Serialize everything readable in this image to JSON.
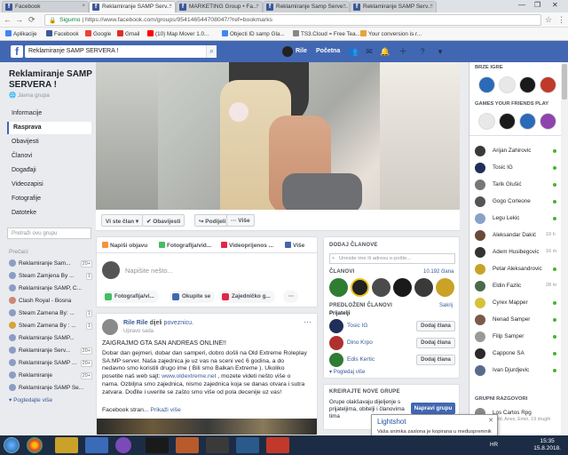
{
  "browser": {
    "tabs": [
      {
        "label": "Facebook",
        "active": false
      },
      {
        "label": "Reklamiranje SAMP Serv...",
        "active": true
      },
      {
        "label": "MARKETING Group • Fa...",
        "active": false
      },
      {
        "label": "Reklamiranje Samp Serve...",
        "active": false
      },
      {
        "label": "Reklamiranje SAMP Serv...",
        "active": false
      }
    ],
    "secure_label": "Sigurno",
    "url": "https://www.facebook.com/groups/954146544708047/?ref=bookmarks",
    "bookmarks": [
      {
        "label": "Aplikacije",
        "color": "#4285f4"
      },
      {
        "label": "Facebook",
        "color": "#3b5998"
      },
      {
        "label": "Google",
        "color": "#ea4335"
      },
      {
        "label": "Gmail",
        "color": "#d93025"
      },
      {
        "label": "(10) Map Mover 1.0...",
        "color": "#ff0000"
      },
      {
        "label": "Objecti ID samp Gla...",
        "color": "#4285f4"
      },
      {
        "label": "TS3.Cloud = Free Tea...",
        "color": "#888888"
      },
      {
        "label": "Your conversion is r...",
        "color": "#e8a33b"
      }
    ]
  },
  "fb_header": {
    "logo": "f",
    "search_value": "Reklamiranje SAMP SERVERA !",
    "user_name": "Rile",
    "home_label": "Početna"
  },
  "left_nav": {
    "group_title": "Reklamiranje SAMP SERVERA !",
    "group_type": "Javna grupa",
    "items": [
      {
        "label": "Informacije",
        "selected": false
      },
      {
        "label": "Rasprava",
        "selected": true
      },
      {
        "label": "Obavijesti",
        "selected": false
      },
      {
        "label": "Članovi",
        "selected": false
      },
      {
        "label": "Događaji",
        "selected": false
      },
      {
        "label": "Videozapisi",
        "selected": false
      },
      {
        "label": "Fotografije",
        "selected": false
      },
      {
        "label": "Datoteke",
        "selected": false
      }
    ],
    "search_placeholder": "Pretraži ovu grupu",
    "recent_heading": "Prečaci",
    "recent": [
      {
        "label": "Reklamiranje Sam...",
        "count": "20+"
      },
      {
        "label": "Steam Zamjena By ...",
        "count": "1"
      },
      {
        "label": "Reklamiranje SAMP, C...",
        "count": ""
      },
      {
        "label": "Clash Royal - Bosna",
        "count": ""
      },
      {
        "label": "Steam Zamena By: ...",
        "count": "1"
      },
      {
        "label": "Steam Zamena By : ...",
        "count": "1"
      },
      {
        "label": "Reklamiranje SAMP...",
        "count": ""
      },
      {
        "label": "Reklamiranje Serv...",
        "count": "20+"
      },
      {
        "label": "Reklamiranje SAMP ...",
        "count": "20+"
      },
      {
        "label": "Reklamiranje",
        "count": "20+"
      },
      {
        "label": "Reklamiranje SAMP Se...",
        "count": ""
      }
    ],
    "see_more": "Pogledajte više"
  },
  "group_bar": {
    "member_btn": "Vi ste član",
    "notif_btn": "Obavijesti",
    "share_btn": "Podijeli",
    "more_btn": "··· Više"
  },
  "composer": {
    "tabs": [
      "Napiši objavu",
      "Fotografija/vid...",
      "Videoprijenos ...",
      "Više"
    ],
    "placeholder": "Napišite nešto...",
    "buttons": [
      "Fotografija/vi...",
      "Okupite se",
      "Zajedničko g..."
    ],
    "more": "···"
  },
  "post": {
    "author": "Rile Rile",
    "action": "dijeli",
    "action_link": "poveznicu.",
    "time": "Upravo sada",
    "title": "ZAIGRAJMO GTA SAN ANDREAS ONLINE!!",
    "body_lines": [
      "Dobar dan gejmeri, dobar dan samperi, dobro došli na Old Extreme Roleplay",
      "SA:MP server. Naša zajednica je uz vas na sceni već 6 godina, a do",
      "nedavno smo koristili drugo ime ( Bili smo Balkan Extreme ). Ukoliko",
      "posetite naš web sajt: ",
      "mozete videti nešto više o",
      "nama. Ozbiljna smo zajednica, nismo zajednica koja se danas otvara i sutra",
      "zatvara. Dođite i uverite se zašto smo više od pola decenije uz vas!"
    ],
    "link_text": "www.oldextreme.net",
    "trailing": "Facebook stran...",
    "see_more": "Prikaži više"
  },
  "right_col": {
    "add_members_h": "DODAJ ČLANOVE",
    "add_placeholder": "Unesite ime ili adresu e-pošte...",
    "members_h": "ČLANOVI",
    "members_count": "10.192 člana",
    "suggested_h": "PREDLOŽENI ČLANOVI",
    "hide": "Sakrij",
    "friends_label": "Prijatelji",
    "suggested": [
      {
        "name": "Tosic IG",
        "btn": "Dodaj člana"
      },
      {
        "name": "Dino Krpo",
        "btn": "Dodaj člana"
      },
      {
        "name": "Edis Kertic",
        "btn": "Dodaj člana"
      }
    ],
    "see_more": "Pogledaj više",
    "create_h": "KREIRAJTE NOVE GRUPE",
    "create_text": "Grupe olakšavaju dijeljenje s prijateljima, obitelji i članovima tima",
    "create_btn": "Napravi grupu"
  },
  "chat": {
    "quick_games_h": "BRZE IGRE",
    "friends_games_h": "GAMES YOUR FRIENDS PLAY",
    "contacts": [
      {
        "name": "Arijan Zahirovic",
        "time": ""
      },
      {
        "name": "Tosic IG",
        "time": ""
      },
      {
        "name": "Tarik Glušić",
        "time": ""
      },
      {
        "name": "Gogo Corleone",
        "time": ""
      },
      {
        "name": "Legu Lekic",
        "time": ""
      },
      {
        "name": "Aleksandar Dakić",
        "time": "19 h"
      },
      {
        "name": "Adem Husibegovic",
        "time": "16 m"
      },
      {
        "name": "Petar Aleksandrovic",
        "time": ""
      },
      {
        "name": "Eldin Fazlic",
        "time": "28 m"
      },
      {
        "name": "Cyrex Mapper",
        "time": ""
      },
      {
        "name": "Nenad Samper",
        "time": ""
      },
      {
        "name": "Filip Samper",
        "time": ""
      },
      {
        "name": "Cappone SA",
        "time": ""
      },
      {
        "name": "Ivan Djurdjevic",
        "time": ""
      }
    ],
    "group_convos_h": "GRUPNI RAZGOVORI",
    "group_convo": "Los Cartos Rpg",
    "group_convo_sub": "Lord, Anes, Emin, 19 drugih"
  },
  "toast": {
    "title": "Lightshot",
    "text": "Vaša snimka zaslona je kopirana u međuspremnik"
  },
  "taskbar": {
    "lang": "HR",
    "time": "15:35",
    "date": "15.8.2018."
  }
}
